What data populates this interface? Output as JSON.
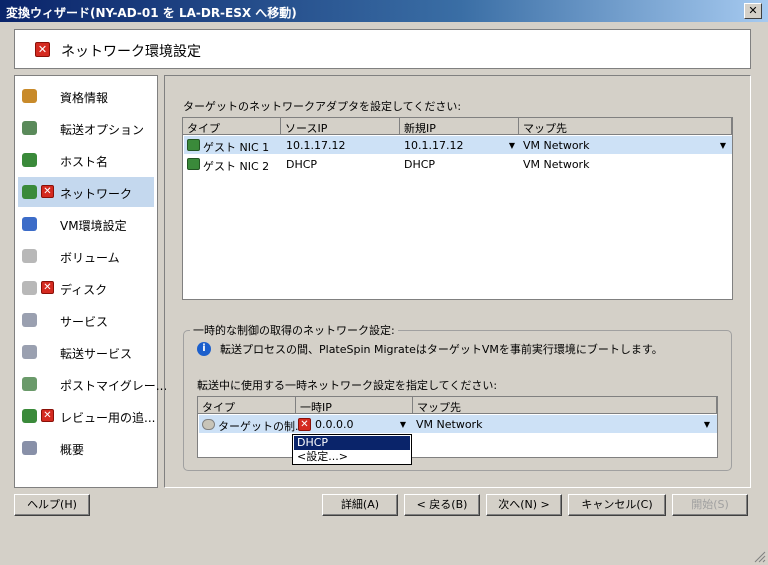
{
  "window": {
    "title": "変換ウィザード(NY-AD-01 を LA-DR-ESX へ移動)",
    "close_glyph": "✕"
  },
  "header": {
    "title": "ネットワーク環境設定"
  },
  "sidebar": {
    "items": [
      {
        "label": "資格情報",
        "icon": "user-key-icon",
        "error": false
      },
      {
        "label": "転送オプション",
        "icon": "transfer-options-icon",
        "error": false
      },
      {
        "label": "ホスト名",
        "icon": "host-icon",
        "error": false
      },
      {
        "label": "ネットワーク",
        "icon": "network-icon",
        "error": true
      },
      {
        "label": "VM環境設定",
        "icon": "vm-config-icon",
        "error": false
      },
      {
        "label": "ボリューム",
        "icon": "volume-icon",
        "error": false
      },
      {
        "label": "ディスク",
        "icon": "disk-icon",
        "error": true
      },
      {
        "label": "サービス",
        "icon": "gear-icon",
        "error": false
      },
      {
        "label": "転送サービス",
        "icon": "gear-icon",
        "error": false
      },
      {
        "label": "ポストマイグレー...",
        "icon": "post-migration-icon",
        "error": false
      },
      {
        "label": "レビュー用の追...",
        "icon": "review-icon",
        "error": true
      },
      {
        "label": "概要",
        "icon": "summary-icon",
        "error": false
      }
    ],
    "selected_index": 3
  },
  "adapters": {
    "prompt": "ターゲットのネットワークアダプタを設定してください:",
    "columns": [
      "タイプ",
      "ソースIP",
      "新規IP",
      "マップ先"
    ],
    "rows": [
      {
        "type": "ゲスト NIC 1",
        "source_ip": "10.1.17.12",
        "new_ip": "10.1.17.12",
        "map": "VM Network"
      },
      {
        "type": "ゲスト NIC 2",
        "source_ip": "DHCP",
        "new_ip": "DHCP",
        "map": "VM Network"
      }
    ]
  },
  "temp_network": {
    "group_title": "一時的な制御の取得のネットワーク設定:",
    "info": "転送プロセスの間、PlateSpin MigrateはターゲットVMを事前実行環境にブートします。",
    "prompt": "転送中に使用する一時ネットワーク設定を指定してください:",
    "columns": [
      "タイプ",
      "一時IP",
      "マップ先"
    ],
    "row": {
      "type": "ターゲットの制...",
      "temp_ip": "0.0.0.0",
      "map": "VM Network"
    },
    "dropdown_options": [
      "DHCP",
      "<設定...>"
    ],
    "dropdown_highlight": 0
  },
  "buttons": {
    "help": "ヘルプ(H)",
    "details": "詳細(A)",
    "back": "< 戻る(B)",
    "next": "次へ(N) >",
    "cancel": "キャンセル(C)",
    "start": "開始(S)"
  },
  "colors": {
    "title_bar": "#0a246a",
    "error_icon": "#d42a20",
    "selection": "#c4d8ee",
    "dropdown_highlight": "#0a246a"
  }
}
